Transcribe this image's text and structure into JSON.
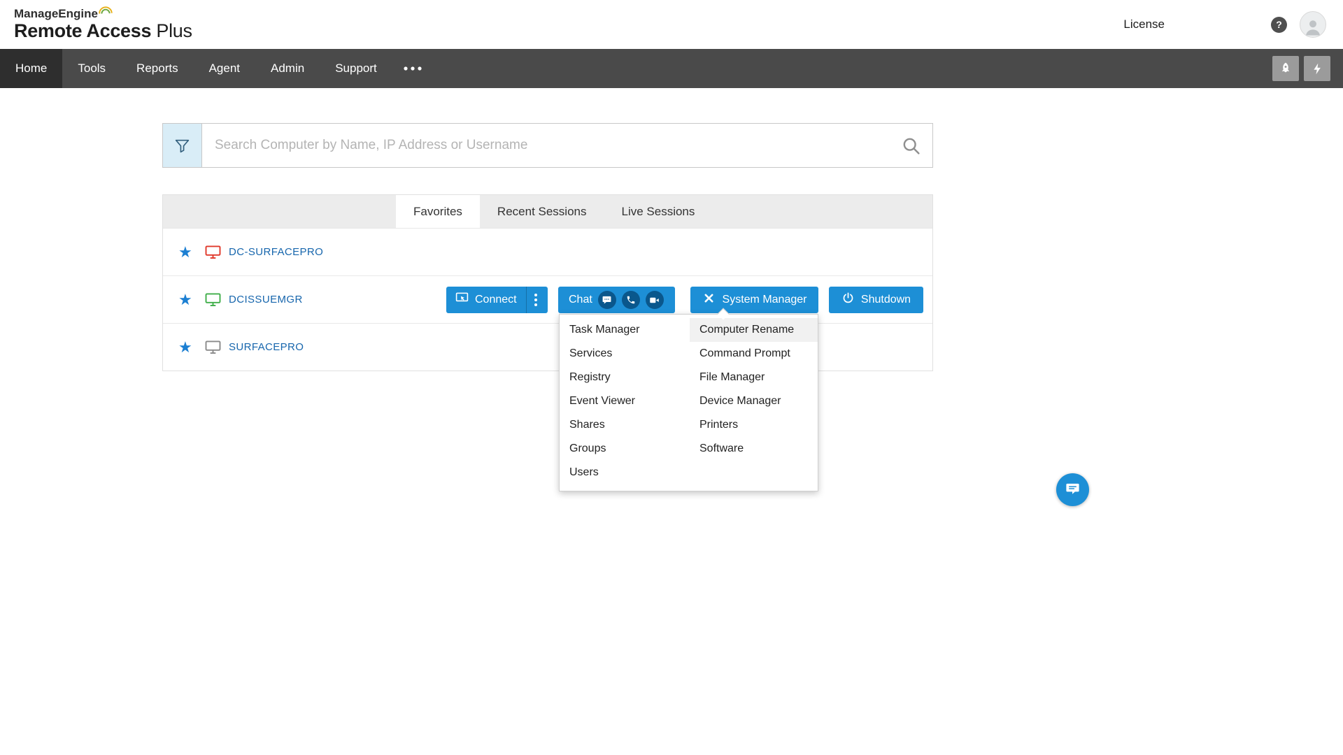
{
  "header": {
    "brand_line1": "ManageEngine",
    "brand_line2_bold": "Remote Access",
    "brand_line2_light": " Plus",
    "license": "License",
    "help_glyph": "?"
  },
  "nav": {
    "items": [
      "Home",
      "Tools",
      "Reports",
      "Agent",
      "Admin",
      "Support"
    ],
    "active_item": "Home"
  },
  "search": {
    "placeholder": "Search Computer by Name, IP Address or Username"
  },
  "tabs": [
    "Favorites",
    "Recent Sessions",
    "Live Sessions"
  ],
  "active_tab": "Favorites",
  "computers": [
    {
      "name": "DC-SURFACEPRO",
      "status_color": "#e0392b"
    },
    {
      "name": "DCISSUEMGR",
      "status_color": "#3fae49"
    },
    {
      "name": "SURFACEPRO",
      "status_color": "#8a8a8a"
    }
  ],
  "row_actions": {
    "connect": "Connect",
    "chat": "Chat",
    "system_manager": "System Manager",
    "shutdown": "Shutdown"
  },
  "system_manager_menu": {
    "column1": [
      "Task Manager",
      "Services",
      "Registry",
      "Event Viewer",
      "Shares",
      "Groups",
      "Users"
    ],
    "column2": [
      "Computer Rename",
      "Command Prompt",
      "File Manager",
      "Device Manager",
      "Printers",
      "Software"
    ],
    "highlighted": "Computer Rename"
  },
  "icons": {
    "brand_swoosh": "rainbow-arc",
    "help": "question-circle",
    "avatar": "person-silhouette",
    "rocket": "rocket",
    "quick_action": "lightning-bolt",
    "more_menu": "horizontal-dots",
    "filter": "funnel",
    "search": "magnifier",
    "favorite": "star",
    "computer": "monitor",
    "connect": "screen-cursor",
    "connect_more": "vertical-dots",
    "chat_bubble": "speech-bubble",
    "voice_call": "phone",
    "video_call": "video-camera",
    "system_manager": "crossed-tools",
    "shutdown": "power",
    "chat_fab": "speech-bubble-lines"
  },
  "colors": {
    "primary_blue": "#1d8fd6",
    "nav_bg": "#4a4a4a",
    "nav_active_bg": "#2e2e2e",
    "link_blue": "#1766ad",
    "circle_dark_blue": "#0a578c"
  }
}
